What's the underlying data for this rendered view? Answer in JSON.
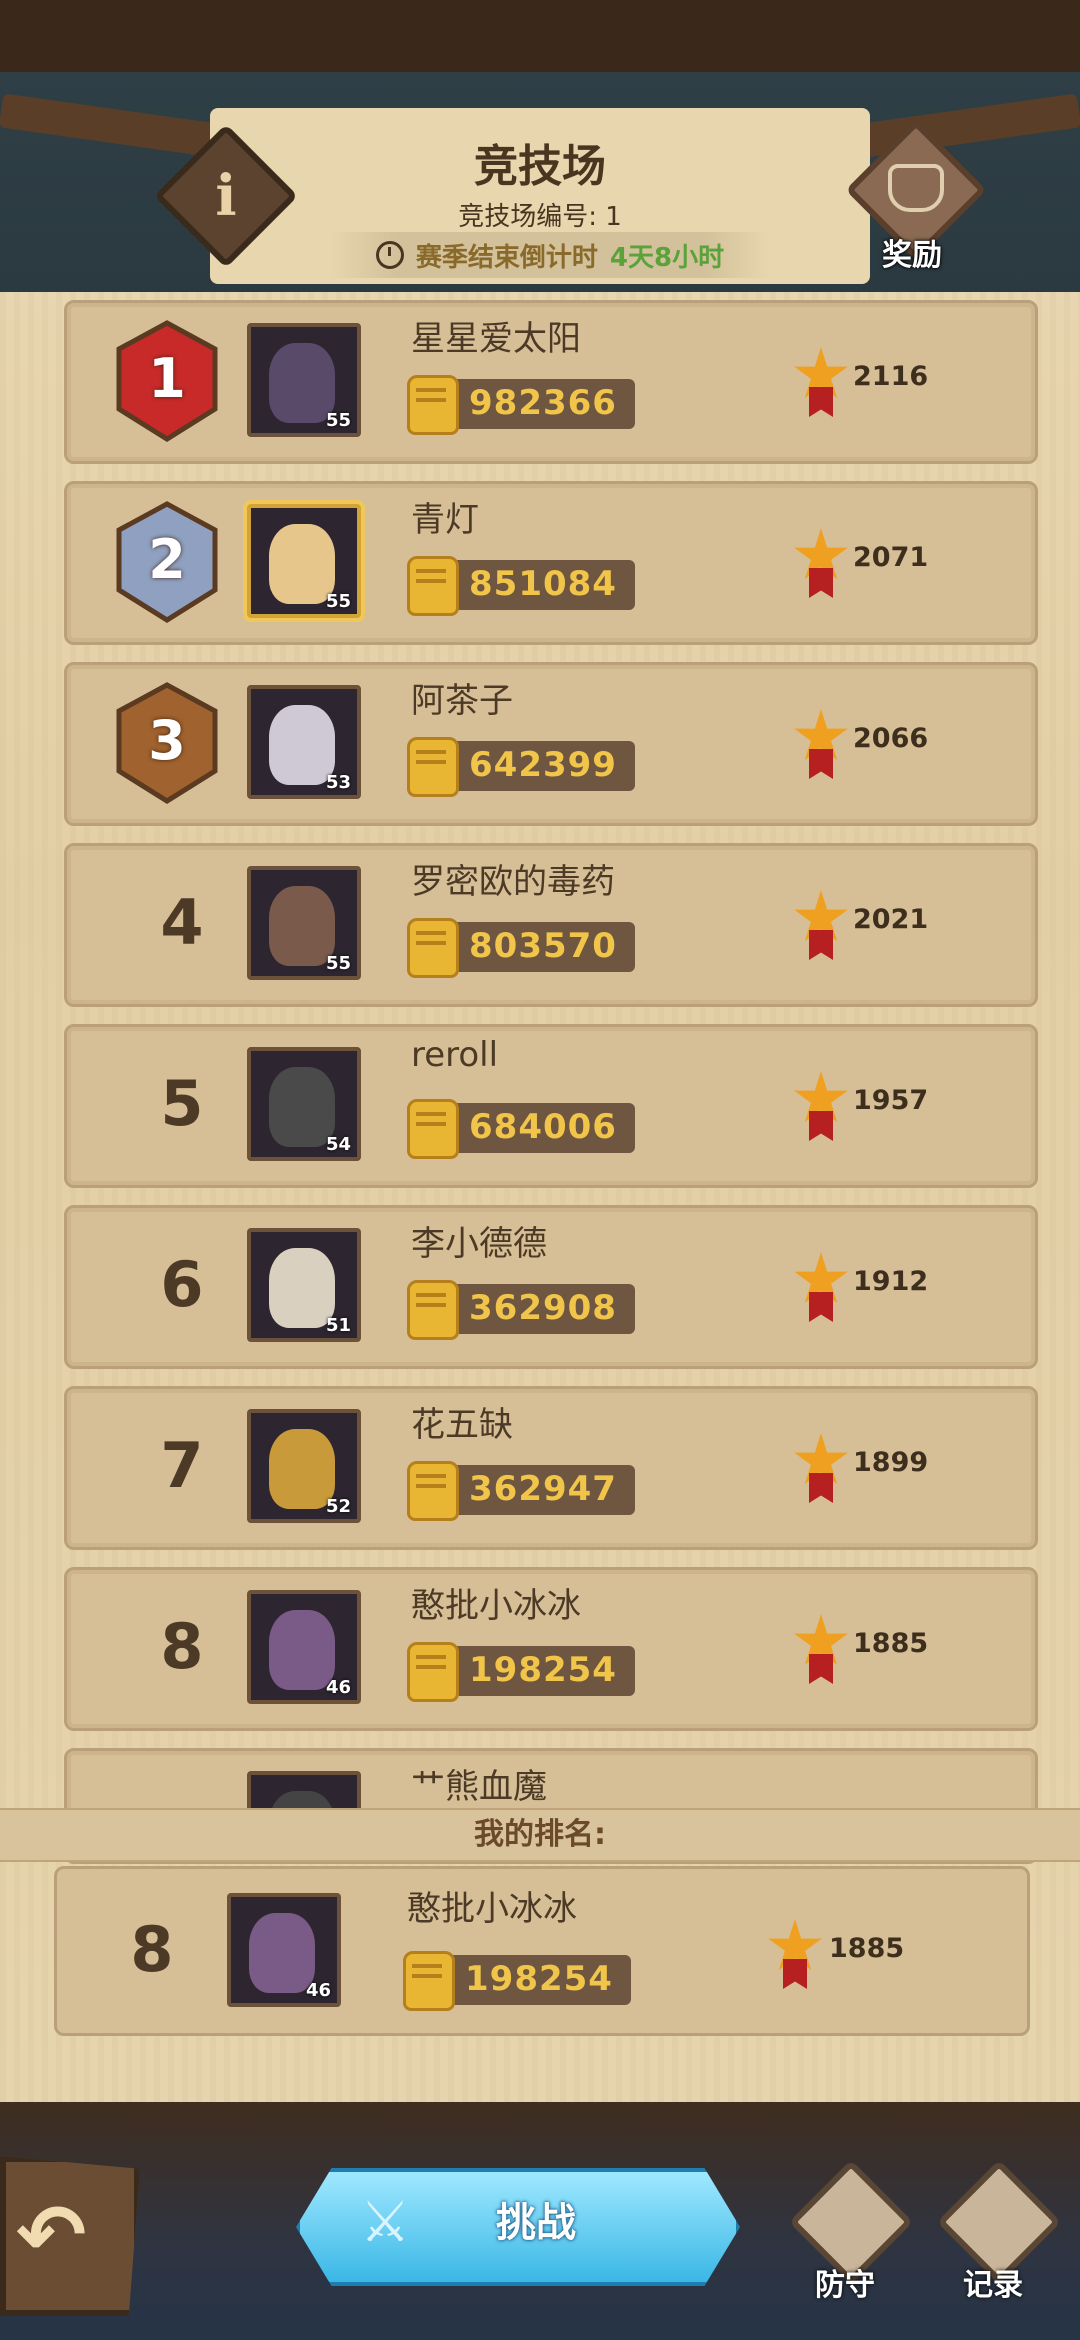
{
  "header": {
    "title": "竞技场",
    "arena_number": "竞技场编号: 1",
    "countdown_label": "赛季结束倒计时",
    "countdown_value": "4天8小时",
    "info_icon": "i",
    "reward_label": "奖励"
  },
  "rankings": [
    {
      "rank": "1",
      "name": "星星爱太阳",
      "power": "982366",
      "score": "2116",
      "level": "55"
    },
    {
      "rank": "2",
      "name": "青灯",
      "power": "851084",
      "score": "2071",
      "level": "55"
    },
    {
      "rank": "3",
      "name": "阿茶子",
      "power": "642399",
      "score": "2066",
      "level": "53"
    },
    {
      "rank": "4",
      "name": "罗密欧的毒药",
      "power": "803570",
      "score": "2021",
      "level": "55"
    },
    {
      "rank": "5",
      "name": "reroll",
      "power": "684006",
      "score": "1957",
      "level": "54"
    },
    {
      "rank": "6",
      "name": "李小德德",
      "power": "362908",
      "score": "1912",
      "level": "51"
    },
    {
      "rank": "7",
      "name": "花五缺",
      "power": "362947",
      "score": "1899",
      "level": "52"
    },
    {
      "rank": "8",
      "name": "憨批小冰冰",
      "power": "198254",
      "score": "1885",
      "level": "46"
    },
    {
      "rank": "",
      "name": "艹熊血魔",
      "power": "",
      "score": "",
      "level": ""
    }
  ],
  "my_rank": {
    "label": "我的排名:",
    "rank": "8",
    "name": "憨批小冰冰",
    "power": "198254",
    "score": "1885",
    "level": "46"
  },
  "footer": {
    "back_icon": "↶",
    "challenge_label": "挑战",
    "defense_label": "防守",
    "record_label": "记录"
  }
}
